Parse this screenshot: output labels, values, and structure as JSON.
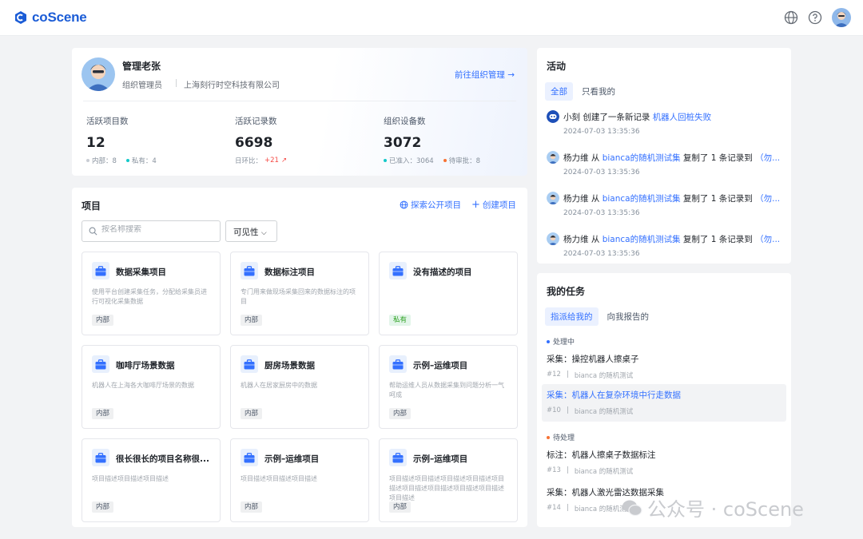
{
  "app": {
    "logo": "coScene"
  },
  "profile": {
    "name": "管理老张",
    "role": "组织管理员",
    "org": "上海刻行时空科技有限公司",
    "manage_link": "前往组织管理",
    "stats": [
      {
        "label": "活跃项目数",
        "value": "12",
        "sub1": "内部：8",
        "sub2": "私有：4"
      },
      {
        "label": "活跃记录数",
        "value": "6698",
        "sub1": "日环比：",
        "sub2": "+21"
      },
      {
        "label": "组织设备数",
        "value": "3072",
        "sub1": "已准入：3064",
        "sub2": "待审批：8"
      }
    ],
    "colors": {
      "internal": "#c9cdd4",
      "private": "#14c9c9",
      "approved": "#14c9c9",
      "pending": "#f77234",
      "up": "#f54a45"
    }
  },
  "projects": {
    "title": "项目",
    "explore": "探索公开项目",
    "create": "创建项目",
    "search_placeholder": "按名称搜索",
    "visibility": "可见性",
    "items": [
      {
        "title": "数据采集项目",
        "desc": "使用平台创建采集任务，分配给采集员进行可视化采集数据",
        "tag": "内部"
      },
      {
        "title": "数据标注项目",
        "desc": "专门用来做现场采集回来的数据标注的项目",
        "tag": "内部"
      },
      {
        "title": "没有描述的项目",
        "desc": "",
        "tag": "私有"
      },
      {
        "title": "咖啡厅场景数据",
        "desc": "机器人在上海各大咖啡厅场景的数据",
        "tag": "内部"
      },
      {
        "title": "厨房场景数据",
        "desc": "机器人在居家厨房中的数据",
        "tag": "内部"
      },
      {
        "title": "示例–运维项目",
        "desc": "帮助运维人员从数据采集到问题分析一气呵成",
        "tag": "内部"
      },
      {
        "title": "很长很长的项目名称很...",
        "desc": "项目描述项目描述项目描述",
        "tag": "内部"
      },
      {
        "title": "示例–运维项目",
        "desc": "项目描述项目描述项目描述",
        "tag": "内部"
      },
      {
        "title": "示例–运维项目",
        "desc": "项目描述项目描述项目描述项目描述项目描述项目描述项目描述项目描述项目描述项目描述",
        "tag": "内部"
      }
    ]
  },
  "activity": {
    "title": "活动",
    "tabs": [
      "全部",
      "只看我的"
    ],
    "items": [
      {
        "user": "小刻",
        "pre": " 创建了一条新记录 ",
        "link": "机器人回桩失败",
        "post": "",
        "tail": "",
        "time": "2024-07-03 13:35:36"
      },
      {
        "user": "杨力维",
        "pre": " 从 ",
        "link": "bianca的随机测试集",
        "post": " 复制了 1 条记录到 ",
        "tail": "（勿...",
        "time": "2024-07-03 13:35:36"
      },
      {
        "user": "杨力维",
        "pre": " 从 ",
        "link": "bianca的随机测试集",
        "post": " 复制了 1 条记录到 ",
        "tail": "（勿...",
        "time": "2024-07-03 13:35:36"
      },
      {
        "user": "杨力维",
        "pre": " 从 ",
        "link": "bianca的随机测试集",
        "post": " 复制了 1 条记录到 ",
        "tail": "（勿...",
        "time": "2024-07-03 13:35:36"
      }
    ]
  },
  "tasks": {
    "title": "我的任务",
    "tabs": [
      "指派给我的",
      "向我报告的"
    ],
    "groups": [
      {
        "label": "处理中",
        "color": "#3370ff"
      },
      {
        "label": "待处理",
        "color": "#f77234"
      }
    ],
    "items": [
      {
        "title": "采集：操控机器人擦桌子",
        "id": "#12",
        "project": "bianca 的随机测试"
      },
      {
        "title": "采集：机器人在复杂环境中行走数据",
        "id": "#10",
        "project": "bianca 的随机测试"
      },
      {
        "title": "标注：机器人擦桌子数据标注",
        "id": "#13",
        "project": "bianca 的随机测试"
      },
      {
        "title": "采集：机器人激光雷达数据采集",
        "id": "#14",
        "project": "bianca 的随机测试"
      }
    ]
  },
  "watermark": "公众号 · coScene"
}
